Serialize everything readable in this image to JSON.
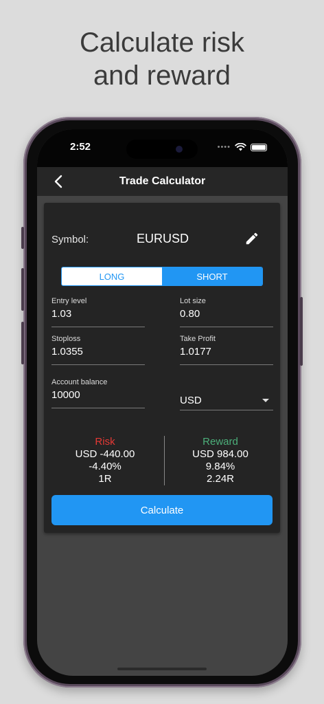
{
  "headline": {
    "line1": "Calculate risk",
    "line2": "and reward"
  },
  "status_bar": {
    "time": "2:52",
    "signal_dots": "••••"
  },
  "nav": {
    "title": "Trade Calculator",
    "back_icon": "chevron-left-icon"
  },
  "symbol": {
    "label": "Symbol:",
    "value": "EURUSD",
    "edit_icon": "pencil-icon"
  },
  "direction": {
    "long_label": "LONG",
    "short_label": "SHORT",
    "selected": "SHORT"
  },
  "fields": {
    "entry_level": {
      "label": "Entry level",
      "value": "1.03"
    },
    "lot_size": {
      "label": "Lot size",
      "value": "0.80"
    },
    "stoploss": {
      "label": "Stoploss",
      "value": "1.0355"
    },
    "take_profit": {
      "label": "Take Profit",
      "value": "1.0177"
    },
    "account_balance": {
      "label": "Account balance",
      "value": "10000"
    },
    "currency": {
      "value": "USD"
    }
  },
  "results": {
    "risk": {
      "label": "Risk",
      "amount": "USD -440.00",
      "percent": "-4.40%",
      "ratio": "1R"
    },
    "reward": {
      "label": "Reward",
      "amount": "USD 984.00",
      "percent": "9.84%",
      "ratio": "2.24R"
    }
  },
  "calculate_label": "Calculate",
  "colors": {
    "accent": "#2196f3",
    "risk": "#e53935",
    "reward": "#4caf7a",
    "card": "#242424",
    "background": "#444444"
  }
}
